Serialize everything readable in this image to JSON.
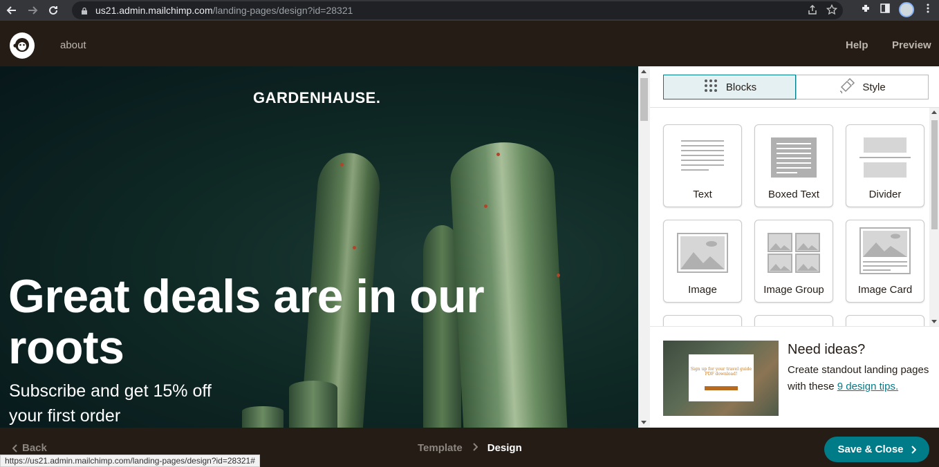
{
  "browser": {
    "url_host": "us21.admin.mailchimp.com",
    "url_path": "/landing-pages/design?id=28321",
    "icons": [
      "back-arrow-icon",
      "forward-arrow-icon",
      "reload-icon",
      "lock-icon",
      "share-icon",
      "star-icon",
      "extensions-icon",
      "sidepanel-icon",
      "profile-avatar",
      "kebab-menu-icon"
    ]
  },
  "header": {
    "title": "about",
    "help_label": "Help",
    "preview_label": "Preview"
  },
  "canvas": {
    "brand": "GARDENHAUSE.",
    "headline": "Great deals are in our roots",
    "subheadline": "Subscribe and get 15% off your first order"
  },
  "panel": {
    "tabs": [
      {
        "label": "Blocks",
        "icon": "grid-dots-icon",
        "active": true
      },
      {
        "label": "Style",
        "icon": "paint-bucket-icon",
        "active": false
      }
    ],
    "blocks": [
      {
        "label": "Text",
        "icon": "text-lines-icon"
      },
      {
        "label": "Boxed Text",
        "icon": "boxed-text-icon"
      },
      {
        "label": "Divider",
        "icon": "divider-icon"
      },
      {
        "label": "Image",
        "icon": "image-icon"
      },
      {
        "label": "Image Group",
        "icon": "image-group-icon"
      },
      {
        "label": "Image Card",
        "icon": "image-card-icon"
      }
    ],
    "ideas": {
      "title": "Need ideas?",
      "text": "Create standout landing pages with these",
      "link": "9 design tips.",
      "card_text": "Sign up for your travel guide PDF download!"
    }
  },
  "footer": {
    "back_label": "Back",
    "steps": [
      "Template",
      "Design"
    ],
    "active_step": "Design",
    "save_label": "Save & Close",
    "status_url": "https://us21.admin.mailchimp.com/landing-pages/design?id=28321#"
  },
  "colors": {
    "header_bg": "#241c15",
    "accent_teal": "#007c89",
    "tab_active_bg": "#e4f0f2"
  }
}
